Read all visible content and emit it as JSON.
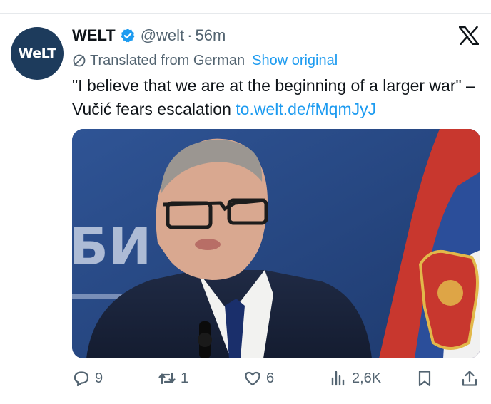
{
  "author": {
    "name": "WELT",
    "handle": "@welt",
    "time": "56m",
    "avatar_text": "WeLT"
  },
  "translation": {
    "label": "Translated from German",
    "show_original": "Show original"
  },
  "tweet": {
    "text": "\"I believe that we are at the beginning of a larger war\" – Vučić fears escalation ",
    "link": "to.welt.de/fMqmJyJ"
  },
  "media": {
    "backdrop_text": "БИ"
  },
  "actions": {
    "replies": "9",
    "reposts": "1",
    "likes": "6",
    "views": "2,6K"
  },
  "colors": {
    "accent": "#1d9bf0",
    "secondary_text": "#536471",
    "avatar_bg": "#1d3b5c"
  },
  "icons": [
    "verified-icon",
    "x-logo-icon",
    "translate-icon",
    "reply-icon",
    "repost-icon",
    "like-icon",
    "views-icon",
    "bookmark-icon",
    "share-icon"
  ]
}
